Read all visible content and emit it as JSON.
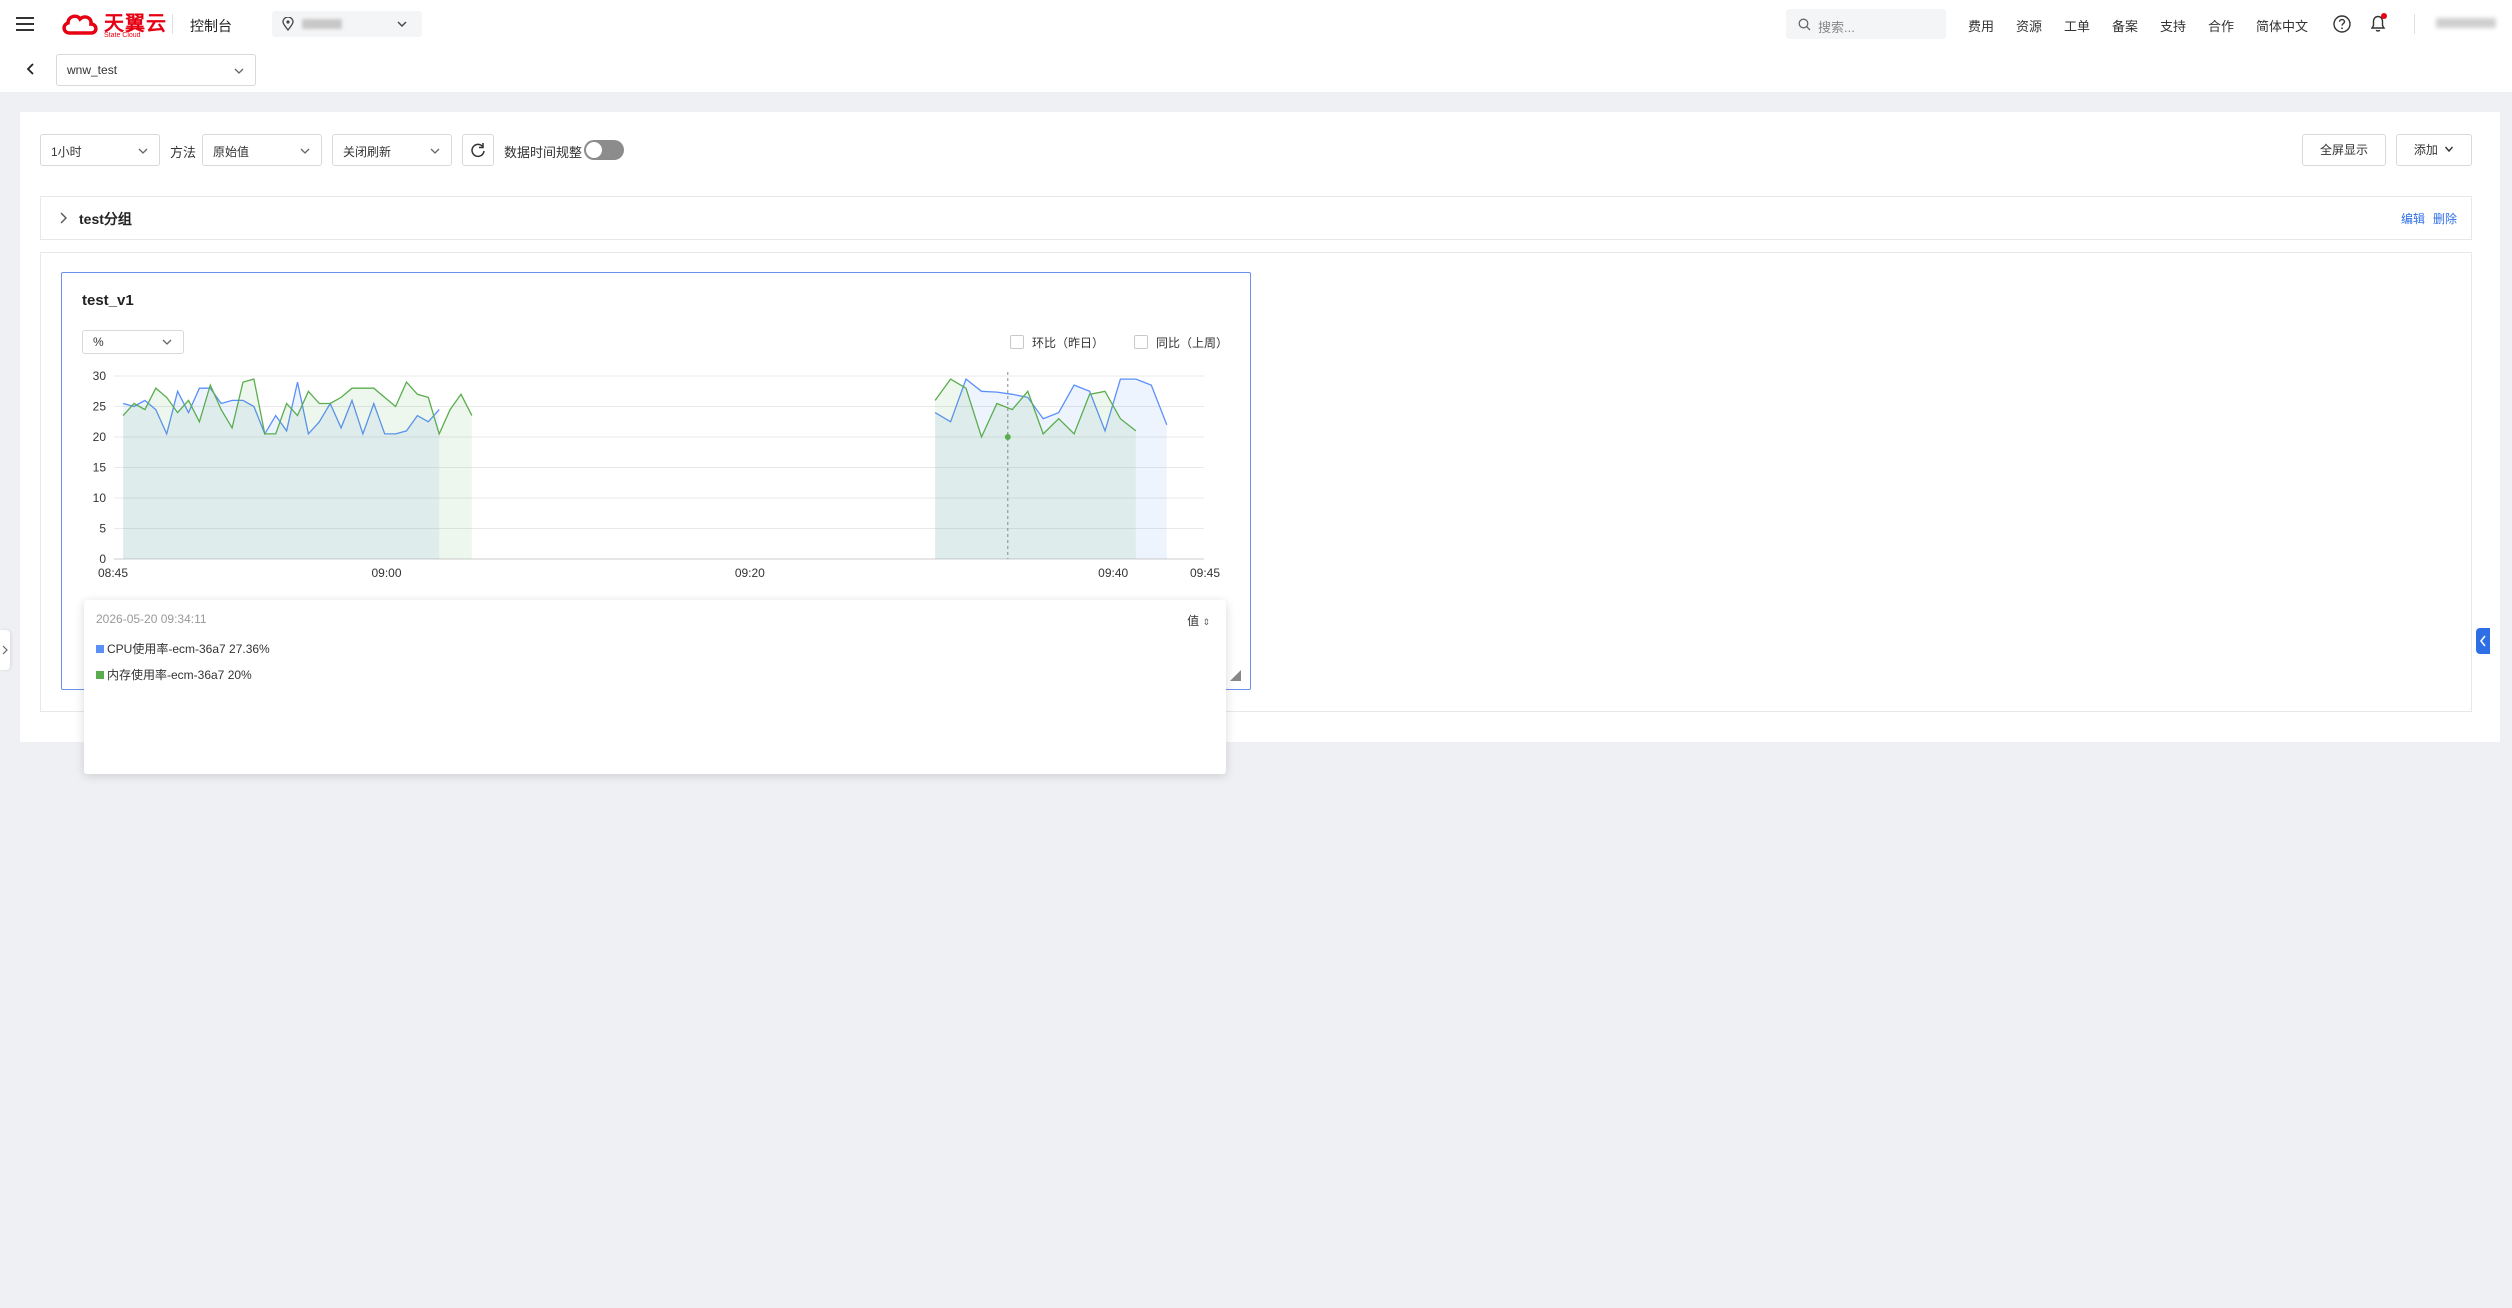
{
  "header": {
    "logo_text": "天翼云",
    "logo_sub": "State Cloud",
    "console_label": "控制台",
    "search_placeholder": "搜索...",
    "nav": [
      "费用",
      "资源",
      "工单",
      "备案",
      "支持",
      "合作",
      "简体中文"
    ]
  },
  "subbar": {
    "instance_value": "wnw_test"
  },
  "toolbar": {
    "time_range": "1小时",
    "method_label": "方法",
    "method_value": "原始值",
    "refresh_value": "关闭刷新",
    "time_adjust_label": "数据时间规整",
    "fullscreen_label": "全屏显示",
    "add_label": "添加"
  },
  "group": {
    "title": "test分组",
    "edit_label": "编辑",
    "delete_label": "删除"
  },
  "card": {
    "title": "test_v1",
    "unit": "%",
    "compare_day_label": "环比（昨日）",
    "compare_week_label": "同比（上周）"
  },
  "tooltip": {
    "time": "2026-05-20 09:34:11",
    "sort_label": "值",
    "rows": [
      {
        "text": "CPU使用率-ecm-36a7 27.36%"
      },
      {
        "text": "内存使用率-ecm-36a7 20%"
      }
    ]
  },
  "colors": {
    "brand": "#e60012",
    "accent": "#2f6fe6",
    "cpu": "#5b8ff9",
    "mem": "#5aad4e"
  },
  "chart_data": {
    "type": "area",
    "title": "test_v1",
    "xlabel": "",
    "ylabel": "%",
    "ylim": [
      0,
      30
    ],
    "yticks": [
      0,
      5,
      10,
      15,
      20,
      25,
      30
    ],
    "xticks": [
      "08:45",
      "09:00",
      "09:20",
      "09:40",
      "09:45"
    ],
    "xtick_minutes": [
      0,
      15,
      35,
      55,
      60
    ],
    "grid": true,
    "highlight_minute": 49.2,
    "series": [
      {
        "name": "CPU使用率-ecm-36a7",
        "segments": [
          {
            "x_start": 0.5,
            "x_step": 0.6,
            "values": [
              25.5,
              25,
              26,
              24.5,
              20.5,
              27.5,
              24,
              28,
              28,
              25.5,
              26,
              26,
              25,
              20.5,
              23.5,
              21,
              29,
              20.5,
              22.5,
              25.5,
              21.5,
              26,
              20.5,
              25.5,
              20.5,
              20.5,
              21,
              23.5,
              22.5,
              24.5
            ]
          },
          {
            "x_start": 45.2,
            "x_step": 0.85,
            "values": [
              24,
              22.5,
              29.5,
              27.5,
              27.36,
              27,
              26.5,
              23,
              24,
              28.5,
              27.5,
              21,
              29.5,
              29.5,
              28.5,
              22
            ]
          }
        ]
      },
      {
        "name": "内存使用率-ecm-36a7",
        "segments": [
          {
            "x_start": 0.5,
            "x_step": 0.6,
            "values": [
              23.5,
              25.5,
              24.5,
              28,
              26.5,
              24,
              26,
              22.5,
              28.5,
              24.5,
              21.5,
              29,
              29.5,
              20.5,
              20.5,
              25.5,
              23.5,
              27.5,
              25.5,
              25.5,
              26.5,
              28,
              28,
              28,
              26.5,
              25,
              29,
              27,
              26.5,
              20.5,
              24.5,
              27,
              23.5
            ]
          },
          {
            "x_start": 45.2,
            "x_step": 0.85,
            "values": [
              26,
              29.5,
              28,
              20,
              25.5,
              24.5,
              27.5,
              20.5,
              23,
              20.5,
              27,
              27.5,
              23,
              21
            ]
          }
        ]
      }
    ]
  }
}
